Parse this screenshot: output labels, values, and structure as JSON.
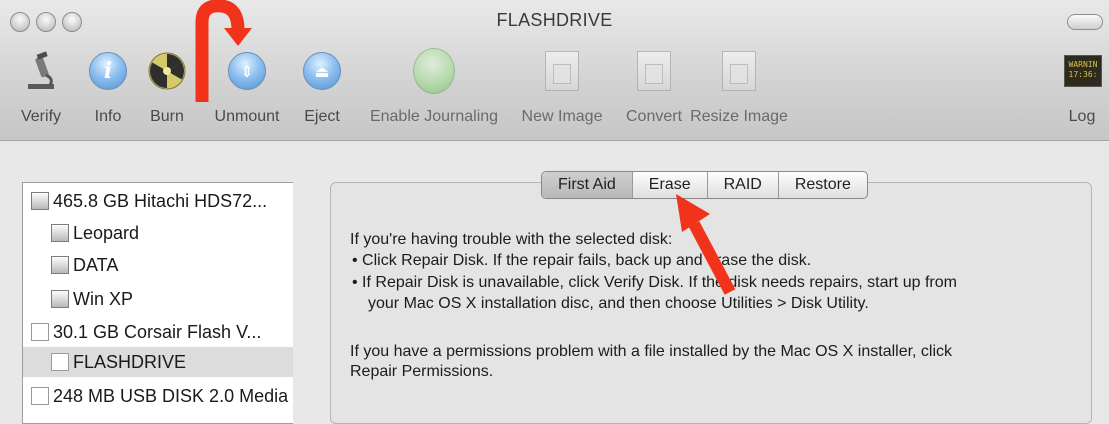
{
  "window": {
    "title": "FLASHDRIVE"
  },
  "toolbar": {
    "items": [
      {
        "label": "Verify",
        "icon": "microscope-icon"
      },
      {
        "label": "Info",
        "icon": "info-icon"
      },
      {
        "label": "Burn",
        "icon": "burn-icon"
      },
      {
        "label": "Unmount",
        "icon": "unmount-icon"
      },
      {
        "label": "Eject",
        "icon": "eject-icon"
      },
      {
        "label": "Enable Journaling",
        "icon": "journaling-icon"
      },
      {
        "label": "New Image",
        "icon": "new-image-icon"
      },
      {
        "label": "Convert",
        "icon": "convert-icon"
      },
      {
        "label": "Resize Image",
        "icon": "resize-image-icon"
      },
      {
        "label": "Log",
        "icon": "log-icon"
      }
    ],
    "log_icon_text": "WARNIN\n17:36:"
  },
  "sidebar": {
    "items": [
      {
        "label": "465.8 GB Hitachi HDS72..."
      },
      {
        "label": "Leopard"
      },
      {
        "label": "DATA"
      },
      {
        "label": "Win XP"
      },
      {
        "label": "30.1 GB Corsair Flash V..."
      },
      {
        "label": "FLASHDRIVE"
      },
      {
        "label": "248 MB USB DISK 2.0 Media"
      }
    ]
  },
  "tabs": [
    {
      "label": "First Aid"
    },
    {
      "label": "Erase"
    },
    {
      "label": "RAID"
    },
    {
      "label": "Restore"
    }
  ],
  "first_aid": {
    "intro": "If you're having trouble with the selected disk:",
    "bullet1": "• Click Repair Disk. If the repair fails, back up and erase the disk.",
    "bullet2a": "• If Repair Disk is unavailable, click Verify Disk. If the disk needs repairs, start up from",
    "bullet2b": "your Mac OS X installation disc, and then choose Utilities > Disk Utility.",
    "perm1": "If you have a permissions problem with a file installed by the Mac OS X installer, click",
    "perm2": "Repair Permissions."
  },
  "colors": {
    "annotation_arrow": "#f2331b",
    "accent_blue": "#4f8fd0"
  }
}
